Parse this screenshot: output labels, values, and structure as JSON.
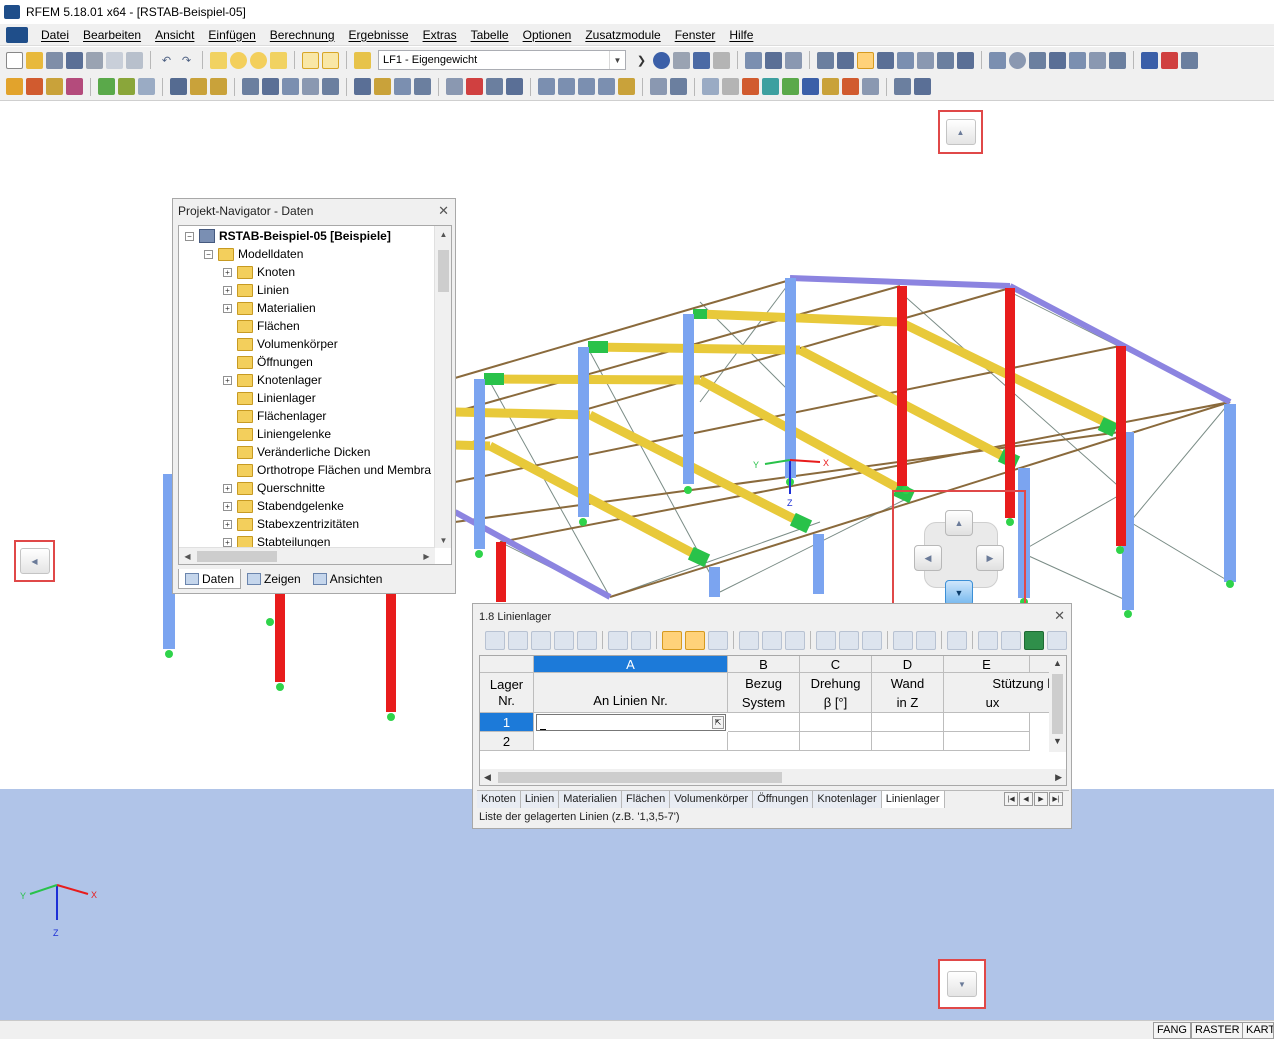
{
  "window": {
    "title": "RFEM 5.18.01 x64 - [RSTAB-Beispiel-05]"
  },
  "menu": [
    "Datei",
    "Bearbeiten",
    "Ansicht",
    "Einfügen",
    "Berechnung",
    "Ergebnisse",
    "Extras",
    "Tabelle",
    "Optionen",
    "Zusatzmodule",
    "Fenster",
    "Hilfe"
  ],
  "toolbar": {
    "load_case": "LF1 - Eigengewicht"
  },
  "navigator": {
    "title": "Projekt-Navigator - Daten",
    "root": "RSTAB-Beispiel-05 [Beispiele]",
    "group": "Modelldaten",
    "items": [
      "Knoten",
      "Linien",
      "Materialien",
      "Flächen",
      "Volumenkörper",
      "Öffnungen",
      "Knotenlager",
      "Linienlager",
      "Flächenlager",
      "Liniengelenke",
      "Veränderliche Dicken",
      "Orthotrope Flächen und Membra",
      "Querschnitte",
      "Stabendgelenke",
      "Stabexzentrizitäten",
      "Stabteilungen"
    ],
    "expandable": [
      true,
      true,
      true,
      false,
      false,
      false,
      true,
      false,
      false,
      false,
      false,
      false,
      true,
      true,
      true,
      true
    ],
    "tabs": [
      "Daten",
      "Zeigen",
      "Ansichten"
    ]
  },
  "table": {
    "title": "1.8 Linienlager",
    "columns": [
      {
        "letter": "",
        "h1": "Lager",
        "h2": "Nr."
      },
      {
        "letter": "A",
        "h1": "",
        "h2": "An Linien Nr."
      },
      {
        "letter": "B",
        "h1": "Bezug",
        "h2": "System"
      },
      {
        "letter": "C",
        "h1": "Drehung",
        "h2": "β [°]"
      },
      {
        "letter": "D",
        "h1": "Wand",
        "h2": "in Z"
      },
      {
        "letter": "E",
        "h1": "Stützung b",
        "h2": "ux"
      }
    ],
    "rows": [
      "1",
      "2"
    ],
    "tabs": [
      "Knoten",
      "Linien",
      "Materialien",
      "Flächen",
      "Volumenkörper",
      "Öffnungen",
      "Knotenlager",
      "Linienlager"
    ],
    "active_tab": "Linienlager",
    "status": "Liste der gelagerten Linien (z.B. '1,3,5-7')"
  },
  "axes": {
    "x": "X",
    "y": "Y",
    "z": "Z"
  },
  "statusbar": [
    "FANG",
    "RASTER",
    "KART"
  ]
}
